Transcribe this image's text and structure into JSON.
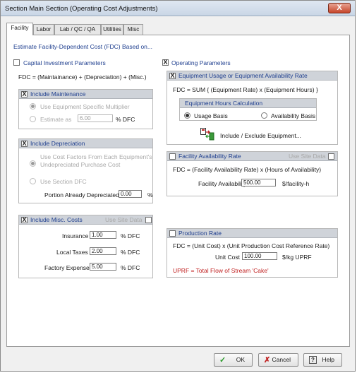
{
  "window": {
    "title": "Section Main Section (Operating Cost Adjustments)",
    "close_glyph": "X"
  },
  "tabs": [
    {
      "label": "Facility"
    },
    {
      "label": "Labor"
    },
    {
      "label": "Lab / QC / QA"
    },
    {
      "label": "Utilities"
    },
    {
      "label": "Misc"
    }
  ],
  "heading": "Estimate Facility-Dependent Cost (FDC) Based on...",
  "capital": {
    "label": "Capital Investment Parameters",
    "checked": false,
    "formula": "FDC = (Maintainance) + (Depreciation) + (Misc.)"
  },
  "maintenance": {
    "label": "Include Maintenance",
    "check_glyph": "X",
    "opt1": "Use Equipment Specific Multiplier",
    "opt2": "Estimate as",
    "value": "6.00",
    "unit": "% DFC"
  },
  "depreciation": {
    "label": "Include Depreciation",
    "check_glyph": "X",
    "opt1_line1": "Use Cost Factors From Each Equipment's",
    "opt1_line2": "Undepreciated Purchase Cost",
    "opt2": "Use Section DFC",
    "portion_label": "Portion Already Depreciated",
    "portion_value": "0.00",
    "portion_unit": "%"
  },
  "misc": {
    "label": "Include Misc. Costs",
    "check_glyph": "X",
    "use_site_data": "Use Site Data",
    "rows": [
      {
        "label": "Insurance",
        "value": "1.00",
        "unit": "% DFC"
      },
      {
        "label": "Local Taxes",
        "value": "2.00",
        "unit": "% DFC"
      },
      {
        "label": "Factory Expense",
        "value": "5.00",
        "unit": "% DFC"
      }
    ]
  },
  "operating": {
    "label": "Operating Parameters",
    "check_glyph": "X"
  },
  "equipment": {
    "label": "Equipment Usage or Equipment Availability Rate",
    "check_glyph": "X",
    "formula": "FDC = SUM { (Equipment Rate) x (Equipment Hours) }",
    "hours_calc_label": "Equipment Hours Calculation",
    "usage_basis": "Usage Basis",
    "availability_basis": "Availability Basis",
    "include_exclude": "Include / Exclude Equipment..."
  },
  "facility_rate": {
    "label": "Facility Availability Rate",
    "use_site_data": "Use Site Data",
    "formula": "FDC = (Facility Availability Rate) x (Hours of Availability)",
    "rate_label": "Facility Availability Rate",
    "rate_value": "500.00",
    "rate_unit": "$/facility-h"
  },
  "production_rate": {
    "label": "Production Rate",
    "formula": "FDC = (Unit Cost) x (Unit Production Cost Reference Rate)",
    "unit_cost_label": "Unit Cost",
    "unit_cost_value": "100.00",
    "unit_cost_unit": "$/kg UPRF",
    "note": "UPRF = Total Flow of Stream 'Cake'"
  },
  "buttons": {
    "ok": "OK",
    "cancel": "Cancel",
    "help": "Help",
    "ok_glyph": "✓",
    "cancel_glyph": "✗",
    "help_glyph": "?"
  },
  "colors": {
    "accent_blue": "#1f3f8f",
    "note_red": "#c02020",
    "group_header": "#cfd3d9"
  }
}
